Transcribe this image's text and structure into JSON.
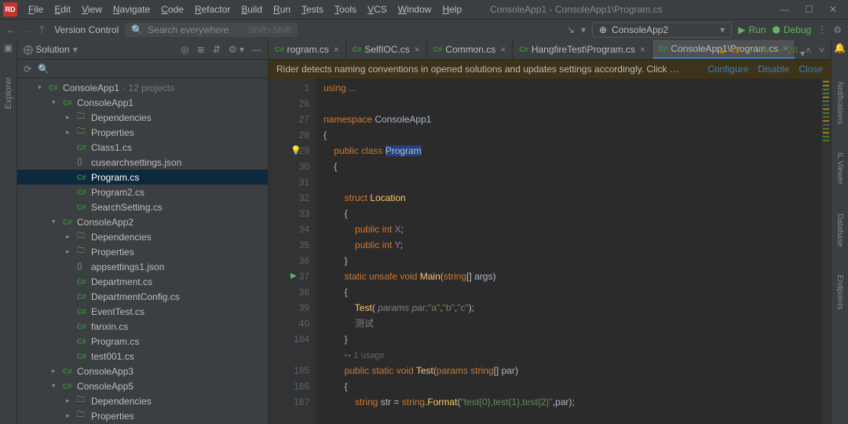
{
  "title": "ConsoleApp1 - ConsoleApp1\\Program.cs",
  "menus": [
    "File",
    "Edit",
    "View",
    "Navigate",
    "Code",
    "Refactor",
    "Build",
    "Run",
    "Tests",
    "Tools",
    "VCS",
    "Window",
    "Help"
  ],
  "toolbar": {
    "vc": "Version Control",
    "search_placeholder": "Search everywhere",
    "search_hint": "Shift+Shift",
    "run_config": "ConsoleApp2",
    "run_label": "Run",
    "debug_label": "Debug"
  },
  "left_tools": [
    "Explorer"
  ],
  "right_tools": [
    "Notifications",
    "IL Viewer",
    "Database",
    "Endpoints"
  ],
  "solution": {
    "title": "Solution",
    "tree": [
      {
        "d": 0,
        "chev": "▾",
        "ico": "cs",
        "text": "ConsoleApp1",
        "hint": " · 12 projects"
      },
      {
        "d": 1,
        "chev": "▾",
        "ico": "cs",
        "text": "ConsoleApp1"
      },
      {
        "d": 2,
        "chev": "▸",
        "ico": "fold",
        "text": "Dependencies"
      },
      {
        "d": 2,
        "chev": "▸",
        "ico": "fold",
        "text": "Properties"
      },
      {
        "d": 2,
        "chev": "",
        "ico": "cs",
        "text": "Class1.cs"
      },
      {
        "d": 2,
        "chev": "",
        "ico": "json",
        "text": "cusearchsettings.json"
      },
      {
        "d": 2,
        "chev": "",
        "ico": "cs",
        "text": "Program.cs",
        "sel": true
      },
      {
        "d": 2,
        "chev": "",
        "ico": "cs",
        "text": "Program2.cs"
      },
      {
        "d": 2,
        "chev": "",
        "ico": "cs",
        "text": "SearchSetting.cs"
      },
      {
        "d": 1,
        "chev": "▾",
        "ico": "cs",
        "text": "ConsoleApp2"
      },
      {
        "d": 2,
        "chev": "▸",
        "ico": "fold",
        "text": "Dependencies"
      },
      {
        "d": 2,
        "chev": "▸",
        "ico": "fold",
        "text": "Properties"
      },
      {
        "d": 2,
        "chev": "",
        "ico": "json",
        "text": "appsettings1.json"
      },
      {
        "d": 2,
        "chev": "",
        "ico": "cs",
        "text": "Department.cs"
      },
      {
        "d": 2,
        "chev": "",
        "ico": "cs",
        "text": "DepartmentConfig.cs"
      },
      {
        "d": 2,
        "chev": "",
        "ico": "cs",
        "text": "EventTest.cs"
      },
      {
        "d": 2,
        "chev": "",
        "ico": "cs",
        "text": "fanxin.cs"
      },
      {
        "d": 2,
        "chev": "",
        "ico": "cs",
        "text": "Program.cs"
      },
      {
        "d": 2,
        "chev": "",
        "ico": "cs",
        "text": "test001.cs"
      },
      {
        "d": 1,
        "chev": "▸",
        "ico": "cs",
        "text": "ConsoleApp3"
      },
      {
        "d": 1,
        "chev": "▾",
        "ico": "cs",
        "text": "ConsoleApp5"
      },
      {
        "d": 2,
        "chev": "▸",
        "ico": "fold",
        "text": "Dependencies"
      },
      {
        "d": 2,
        "chev": "▸",
        "ico": "fold",
        "text": "Properties"
      }
    ]
  },
  "tabs": [
    {
      "label": "rogram.cs",
      "active": false
    },
    {
      "label": "SelfIOC.cs",
      "active": false
    },
    {
      "label": "Common.cs",
      "active": false
    },
    {
      "label": "HangfireTest\\Program.cs",
      "active": false
    },
    {
      "label": "ConsoleApp1\\Program.cs",
      "active": true
    }
  ],
  "banner": {
    "text": "Rider detects naming conventions in opened solutions and updates settings accordingly. Click …",
    "links": [
      "Configure",
      "Disable",
      "Close"
    ]
  },
  "stats": {
    "warn": "43",
    "ok": "18",
    "ok2": "24"
  },
  "code": {
    "lines": [
      {
        "n": 1,
        "html": "<span class='kw'>using</span> <span class='dots'>...</span>"
      },
      {
        "n": 26,
        "html": ""
      },
      {
        "n": 27,
        "html": "<span class='kw'>namespace</span> <span class='cn'>ConsoleApp1</span>"
      },
      {
        "n": 28,
        "html": "<span class='curl'>{</span>"
      },
      {
        "n": 29,
        "bulb": true,
        "html": "    <span class='kw'>public</span> <span class='kw'>class</span> <span class='sel2'>Program</span>"
      },
      {
        "n": 30,
        "html": "    <span class='curl'>{</span>"
      },
      {
        "n": 31,
        "html": ""
      },
      {
        "n": 32,
        "html": "        <span class='kw'>struct</span> <span class='id'>Location</span>"
      },
      {
        "n": 33,
        "html": "        <span class='curl'>{</span>"
      },
      {
        "n": 34,
        "html": "            <span class='kw'>public</span> <span class='kw'>int</span> <span class='mbr'>X</span>;"
      },
      {
        "n": 35,
        "html": "            <span class='kw'>public</span> <span class='kw'>int</span> <span class='mbr'>Y</span>;"
      },
      {
        "n": 36,
        "html": "        <span class='curl'>}</span>"
      },
      {
        "n": 37,
        "play": true,
        "html": "        <span class='kw'>static</span> <span class='kw'>unsafe</span> <span class='kw'>void</span> <span class='id'>Main</span>(<span class='kw'>string</span>[] <span class='ty'>args</span>)"
      },
      {
        "n": 38,
        "html": "        <span class='curl'>{</span>"
      },
      {
        "n": 39,
        "html": "            <span class='id'>Test</span>(<span class='par'> params par:</span><span class='str'>\"a\"</span>,<span class='str'>\"b\"</span>,<span class='str'>\"c\"</span>);"
      },
      {
        "n": 40,
        "html": "            <span class='us'>测试</span>"
      },
      {
        "n": 184,
        "html": "        <span class='curl'>}</span>"
      },
      {
        "n": "",
        "html": "        <span class='hint2'>⮡ 1 usage</span>"
      },
      {
        "n": 185,
        "html": "        <span class='kw'>public</span> <span class='kw'>static</span> <span class='kw'>void</span> <span class='id'>Test</span>(<span class='kw'>params</span> <span class='kw'>string</span>[] <span class='ty'>par</span>)"
      },
      {
        "n": 186,
        "html": "        <span class='curl'>{</span>"
      },
      {
        "n": 187,
        "html": "            <span class='kw'>string</span> <span class='ty'>str</span> = <span class='kw'>string</span>.<span class='id'>Format</span>(<span class='str'>\"test{0},test{1},test{2}\"</span>,<span class='ty'>par</span>);"
      }
    ]
  }
}
